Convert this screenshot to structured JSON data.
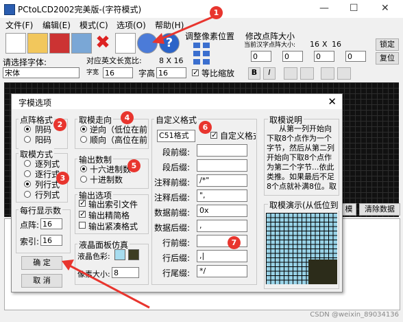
{
  "app": {
    "title": "PCtoLCD2002完美版-(字符模式)"
  },
  "menu": [
    "文件(F)",
    "编辑(E)",
    "模式(C)",
    "选项(O)",
    "帮助(H)"
  ],
  "toolbar": {
    "pixel_adjust_label": "调整像素位置",
    "dot_matrix_label": "修改点阵大小",
    "dot_matrix_sub": "当前汉字点阵大小:",
    "dot_w": "16",
    "dot_x": "X",
    "dot_h": "16",
    "lock_button": "锁定",
    "restore_button": "复位",
    "spin_values": [
      "0",
      "0",
      "0",
      "0"
    ],
    "select_font_label": "请选择字体:",
    "font_value": "宋体",
    "width_label_top": "对应英文长宽比:",
    "ratio_value": "8  X  16",
    "width_label": "字宽",
    "width_value": "16",
    "height_label": "字高",
    "height_value": "16",
    "scale_label": "等比缩放",
    "bold_button": "B",
    "italic_button": "I"
  },
  "right_buttons": {
    "generate_label": "模",
    "clear_label": "清除数据"
  },
  "dialog": {
    "title": "字模选项",
    "close": "✕",
    "dot_format": {
      "label": "点阵格式",
      "options": [
        "阴码",
        "阳码"
      ],
      "selected": 0
    },
    "mode": {
      "label": "取模方式",
      "options": [
        "逐列式",
        "逐行式",
        "列行式",
        "行列式"
      ],
      "selected": 2
    },
    "per_line": {
      "label": "每行显示数",
      "dot_label": "点阵:",
      "dot_value": "16",
      "index_label": "索引:",
      "index_value": "16"
    },
    "direction": {
      "label": "取模走向",
      "options": [
        "逆向（低位在前",
        "顺向（高位在前"
      ],
      "selected": 0
    },
    "number_base": {
      "label": "输出数制",
      "options": [
        "十六进制数",
        "十进制数"
      ],
      "selected": 0
    },
    "output": {
      "label": "输出选项",
      "options": [
        "输出索引文件",
        "输出精简格",
        "输出紧凑格式"
      ],
      "checked": [
        true,
        true,
        false
      ]
    },
    "lcd": {
      "label": "液晶面板仿真",
      "color_label": "液晶色彩:",
      "pixel_label": "像素大小:",
      "pixel_value": "8",
      "color_on": "#a7dcef",
      "color_off": "#3d3d22"
    },
    "custom": {
      "label": "自定义格式",
      "format_value": "C51格式",
      "custom_check": "自定义格式",
      "rows": [
        {
          "label": "段前缀:",
          "value": ""
        },
        {
          "label": "段后缀:",
          "value": ""
        },
        {
          "label": "注释前缀:",
          "value": "/*\""
        },
        {
          "label": "注释后缀:",
          "value": "\","
        },
        {
          "label": "数据前缀:",
          "value": "0x"
        },
        {
          "label": "数据后缀:",
          "value": ","
        },
        {
          "label": "行前缀:",
          "value": ""
        },
        {
          "label": "行后缀:",
          "value": ",|"
        },
        {
          "label": "行尾缀:",
          "value": "*/"
        }
      ]
    },
    "explain": {
      "label": "取模说明",
      "text": "从第一列开始向下取8个点作为一个字节，然后从第二列开始向下取8个点作为第二个字节...依此类推。如果最后不足8个点就补满8位。取模顺序是从低到"
    },
    "demo": {
      "label": "取模演示(从低位到"
    },
    "ok_button": "确  定",
    "cancel_button": "取  消"
  },
  "badges": [
    "1",
    "2",
    "3",
    "4",
    "5",
    "6",
    "7"
  ],
  "watermark": "CSDN @weixin_89034136",
  "colors": {
    "badge": "#e8352e",
    "arrow": "#e8352e",
    "lcd_bg": "#111111"
  }
}
